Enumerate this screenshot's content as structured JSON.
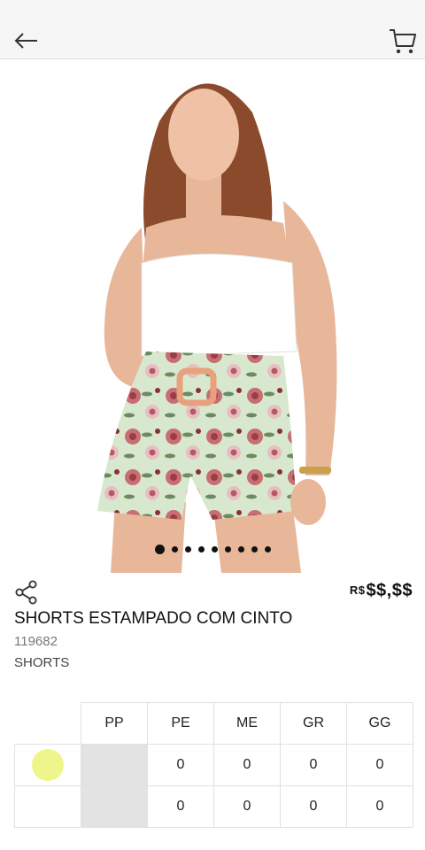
{
  "header": {
    "back_icon": "arrow-left-icon",
    "cart_icon": "cart-icon"
  },
  "product": {
    "image_alt": "Model wearing white halter top and floral print shorts with belt",
    "gallery_dots": 9,
    "gallery_active": 0,
    "share_icon": "share-icon",
    "currency": "R$",
    "price": "$$,$$",
    "title": "SHORTS ESTAMPADO COM CINTO",
    "code": "119682",
    "category": "SHORTS"
  },
  "grid": {
    "sizes": [
      "PP",
      "PE",
      "ME",
      "GR",
      "GG"
    ],
    "rows": [
      {
        "color": "#eef58a",
        "values": [
          "",
          "0",
          "0",
          "0",
          "0"
        ],
        "disabled": [
          true,
          false,
          false,
          false,
          false
        ]
      },
      {
        "color": "#ffffff",
        "values": [
          "",
          "0",
          "0",
          "0",
          "0"
        ],
        "disabled": [
          true,
          false,
          false,
          false,
          false
        ]
      }
    ]
  }
}
